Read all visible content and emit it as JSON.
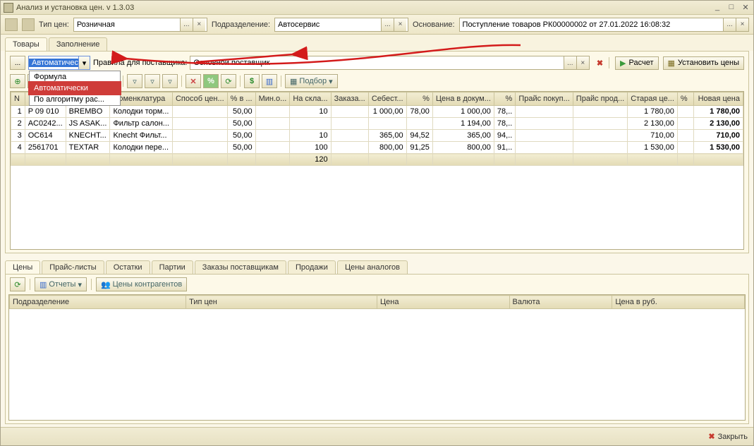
{
  "window": {
    "title": "Анализ и установка цен. v 1.3.03"
  },
  "topbar": {
    "price_type_label": "Тип цен:",
    "price_type_value": "Розничная",
    "subdivision_label": "Подразделение:",
    "subdivision_value": "Автосервис",
    "basis_label": "Основание:",
    "basis_value": "Поступление товаров РК00000002 от 27.01.2022 16:08:32"
  },
  "main_tabs": {
    "items": [
      "Товары",
      "Заполнение"
    ],
    "active": 0
  },
  "filter": {
    "dropdown_value": "Автоматичес",
    "dropdown_options": [
      "Формула",
      "Автоматически",
      "По алгоритму рас..."
    ],
    "dropdown_highlight": 1,
    "rules_label": "Правила для поставщика:",
    "supplier_value": "Основной поставщик"
  },
  "actions": {
    "calc_label": "Расчет",
    "set_prices_label": "Установить цены",
    "podbor_label": "Подбор"
  },
  "grid": {
    "columns": [
      "N",
      "",
      "",
      "Номенклатура",
      "Способ цен...",
      "% в ...",
      "Мин.о...",
      "На скла...",
      "Заказа...",
      "Себест...",
      "%",
      "Цена в докум...",
      "%",
      "Прайс покуп...",
      "Прайс прод...",
      "Старая це...",
      "%",
      "Новая цена"
    ],
    "rows": [
      {
        "n": "1",
        "code": "P 09 010",
        "brand": "BREMBO",
        "name": "Колодки торм...",
        "method": "",
        "pct": "50,00",
        "min": "",
        "stock": "10",
        "order": "",
        "cost": "1 000,00",
        "p1": "78,00",
        "doc": "1 000,00",
        "p2": "78,..",
        "buy": "",
        "sell": "",
        "old": "1 780,00",
        "p3": "",
        "newp": "1 780,00"
      },
      {
        "n": "2",
        "code": "AC0242...",
        "brand": "JS ASAK...",
        "name": "Фильтр салон...",
        "method": "",
        "pct": "50,00",
        "min": "",
        "stock": "",
        "order": "",
        "cost": "",
        "p1": "",
        "doc": "1 194,00",
        "p2": "78,..",
        "buy": "",
        "sell": "",
        "old": "2 130,00",
        "p3": "",
        "newp": "2 130,00"
      },
      {
        "n": "3",
        "code": "OC614",
        "brand": "KNECHT...",
        "name": "Knecht Фильт...",
        "method": "",
        "pct": "50,00",
        "min": "",
        "stock": "10",
        "order": "",
        "cost": "365,00",
        "p1": "94,52",
        "doc": "365,00",
        "p2": "94,..",
        "buy": "",
        "sell": "",
        "old": "710,00",
        "p3": "",
        "newp": "710,00"
      },
      {
        "n": "4",
        "code": "2561701",
        "brand": "TEXTAR",
        "name": "Колодки пере...",
        "method": "",
        "pct": "50,00",
        "min": "",
        "stock": "100",
        "order": "",
        "cost": "800,00",
        "p1": "91,25",
        "doc": "800,00",
        "p2": "91,..",
        "buy": "",
        "sell": "",
        "old": "1 530,00",
        "p3": "",
        "newp": "1 530,00"
      }
    ],
    "footer_stock": "120"
  },
  "bottom_tabs": {
    "items": [
      "Цены",
      "Прайс-листы",
      "Остатки",
      "Партии",
      "Заказы поставщикам",
      "Продажи",
      "Цены аналогов"
    ],
    "active": 0
  },
  "bottom_toolbar": {
    "reports_label": "Отчеты",
    "contragent_prices_label": "Цены контрагентов"
  },
  "bottom_grid": {
    "columns": [
      "Подразделение",
      "Тип цен",
      "Цена",
      "Валюта",
      "Цена в руб."
    ]
  },
  "footer": {
    "close_label": "Закрыть"
  }
}
